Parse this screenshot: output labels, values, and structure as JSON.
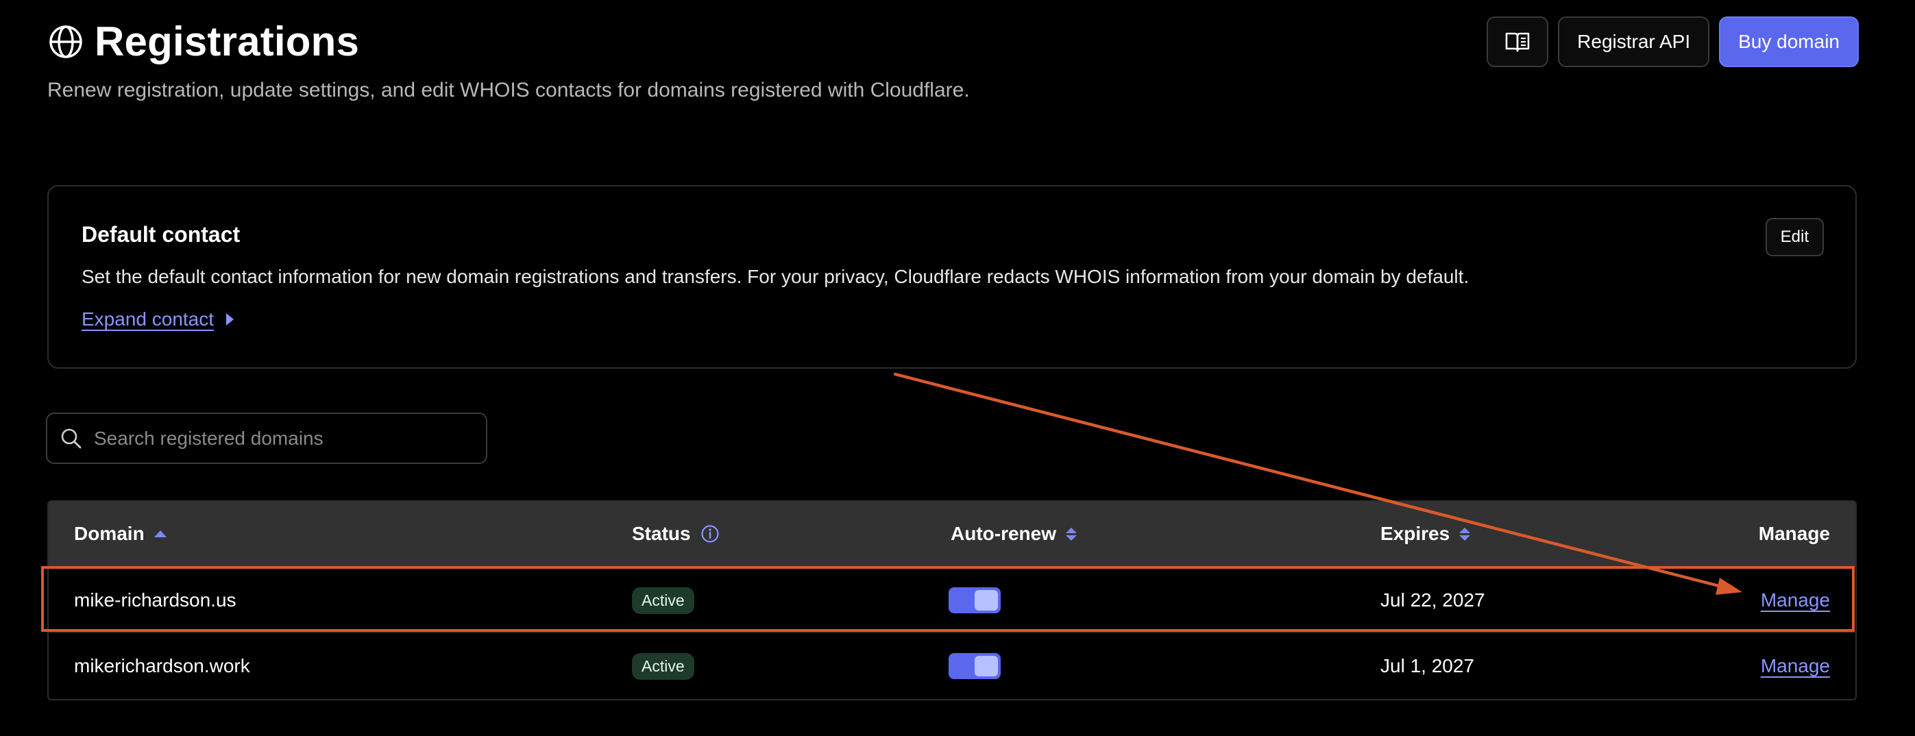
{
  "header": {
    "title": "Registrations",
    "subtitle": "Renew registration, update settings, and edit WHOIS contacts for domains registered with Cloudflare.",
    "docs_icon": "book-icon",
    "registrar_api_label": "Registrar API",
    "buy_domain_label": "Buy domain"
  },
  "contact": {
    "title": "Default contact",
    "description": "Set the default contact information for new domain registrations and transfers. For your privacy, Cloudflare redacts WHOIS information from your domain by default.",
    "expand_label": "Expand contact",
    "edit_label": "Edit"
  },
  "search": {
    "placeholder": "Search registered domains"
  },
  "table": {
    "columns": {
      "domain": "Domain",
      "status": "Status",
      "auto_renew": "Auto-renew",
      "expires": "Expires",
      "manage": "Manage"
    },
    "rows": [
      {
        "domain": "mike-richardson.us",
        "status": "Active",
        "auto_renew": true,
        "expires": "Jul 22, 2027",
        "manage": "Manage"
      },
      {
        "domain": "mikerichardson.work",
        "status": "Active",
        "auto_renew": true,
        "expires": "Jul 1, 2027",
        "manage": "Manage"
      }
    ]
  },
  "colors": {
    "accent": "#5a68ee",
    "link": "#8a94ff",
    "annotation": "#d95a2b",
    "badge_bg": "#1d3a2a"
  }
}
